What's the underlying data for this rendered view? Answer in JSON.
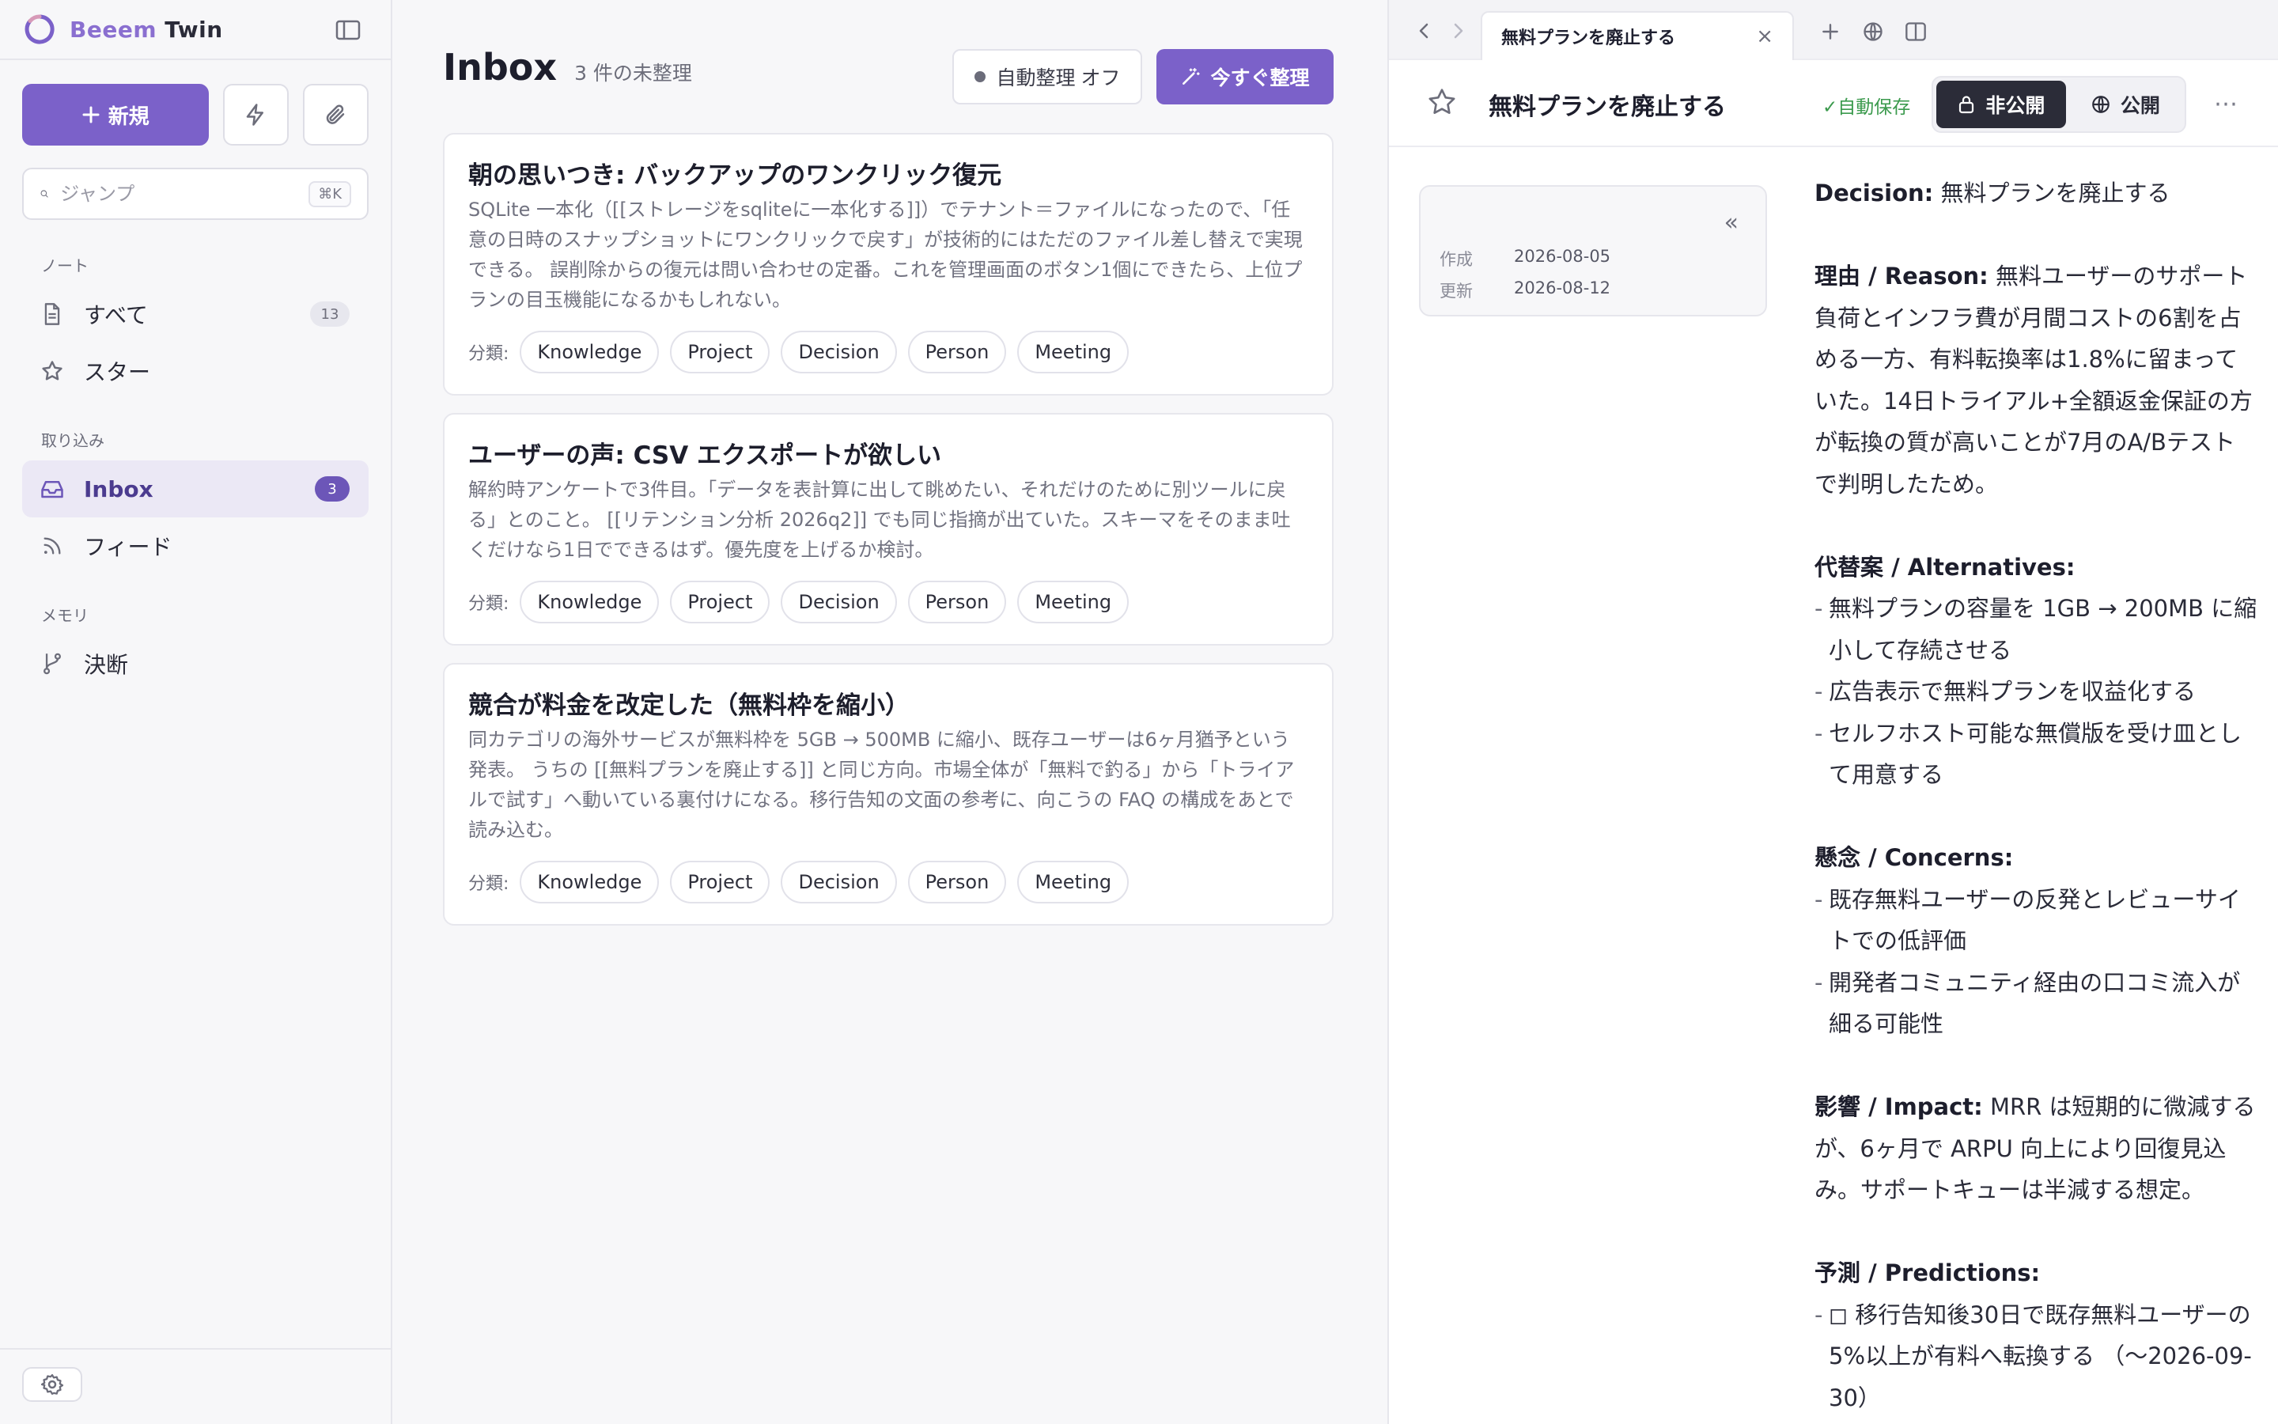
{
  "brand": {
    "name_part1": "Beeem",
    "name_part2": "Twin"
  },
  "sidebar": {
    "new_button": "新規",
    "search": {
      "placeholder": "ジャンプ",
      "shortcut": "⌘K"
    },
    "sections": {
      "notes": "ノート",
      "capture": "取り込み",
      "memory": "メモリ"
    },
    "items": {
      "all": {
        "label": "すべて",
        "count": "13"
      },
      "starred": {
        "label": "スター"
      },
      "inbox": {
        "label": "Inbox",
        "count": "3"
      },
      "feed": {
        "label": "フィード"
      },
      "decisions": {
        "label": "決断"
      }
    }
  },
  "inbox": {
    "title": "Inbox",
    "count_text": "3 件の未整理",
    "auto_button": "自動整理 オフ",
    "now_button": "今すぐ整理",
    "tags_label": "分類:",
    "tags": [
      "Knowledge",
      "Project",
      "Decision",
      "Person",
      "Meeting"
    ],
    "cards": [
      {
        "title": "朝の思いつき: バックアップのワンクリック復元",
        "body": "SQLite 一本化（[[ストレージをsqliteに一本化する]]）でテナント＝ファイルになったので、「任意の日時のスナップショットにワンクリックで戻す」が技術的にはただのファイル差し替えで実現できる。 誤削除からの復元は問い合わせの定番。これを管理画面のボタン1個にできたら、上位プランの目玉機能になるかもしれない。"
      },
      {
        "title": "ユーザーの声: CSV エクスポートが欲しい",
        "body": "解約時アンケートで3件目。「データを表計算に出して眺めたい、それだけのために別ツールに戻る」とのこと。 [[リテンション分析 2026q2]] でも同じ指摘が出ていた。スキーマをそのまま吐くだけなら1日でできるはず。優先度を上げるか検討。"
      },
      {
        "title": "競合が料金を改定した（無料枠を縮小）",
        "body": "同カテゴリの海外サービスが無料枠を 5GB → 500MB に縮小、既存ユーザーは6ヶ月猶予という発表。 うちの [[無料プランを廃止する]] と同じ方向。市場全体が「無料で釣る」から「トライアルで試す」へ動いている裏付けになる。移行告知の文面の参考に、向こうの FAQ の構成をあとで読み込む。"
      }
    ]
  },
  "detail": {
    "tab_title": "無料プランを廃止する",
    "doc_title": "無料プランを廃止する",
    "autosave": "✓自動保存",
    "private_label": "非公開",
    "public_label": "公開",
    "meta": {
      "created_label": "作成",
      "created": "2026-08-05",
      "updated_label": "更新",
      "updated": "2026-08-12"
    },
    "body": {
      "decision_label": "Decision:",
      "decision_text": " 無料プランを廃止する",
      "reason_label": "理由 / Reason:",
      "reason_text": " 無料ユーザーのサポート負荷とインフラ費が月間コストの6割を占める一方、有料転換率は1.8%に留まっていた。14日トライアル+全額返金保証の方が転換の質が高いことが7月のA/Bテストで判明したため。",
      "alternatives_label": "代替案 / Alternatives:",
      "alternatives": [
        "無料プランの容量を 1GB → 200MB に縮小して存続させる",
        "広告表示で無料プランを収益化する",
        "セルフホスト可能な無償版を受け皿として用意する"
      ],
      "concerns_label": "懸念 / Concerns:",
      "concerns": [
        "既存無料ユーザーの反発とレビューサイトでの低評価",
        "開発者コミュニティ経由の口コミ流入が細る可能性"
      ],
      "impact_label": "影響 / Impact:",
      "impact_text": " MRR は短期的に微減するが、6ヶ月で ARPU 向上により回復見込み。サポートキューは半減する想定。",
      "predictions_label": "予測 / Predictions:",
      "predictions": [
        "◻ 移行告知後30日で既存無料ユーザーの5%以上が有料へ転換する （〜2026-09-30）"
      ]
    }
  },
  "colors": {
    "accent": "#7b61c9",
    "autosave": "#3b9a4d"
  },
  "icons": [
    "logo-icon",
    "sidebar-toggle-icon",
    "plus-icon",
    "bolt-icon",
    "paperclip-icon",
    "search-icon",
    "document-icon",
    "star-icon",
    "inbox-icon",
    "rss-icon",
    "branch-icon",
    "gear-icon",
    "wand-icon",
    "chevron-left-icon",
    "chevron-right-icon",
    "close-icon",
    "globe-icon",
    "split-view-icon",
    "lock-icon",
    "more-icon",
    "collapse-icon"
  ]
}
